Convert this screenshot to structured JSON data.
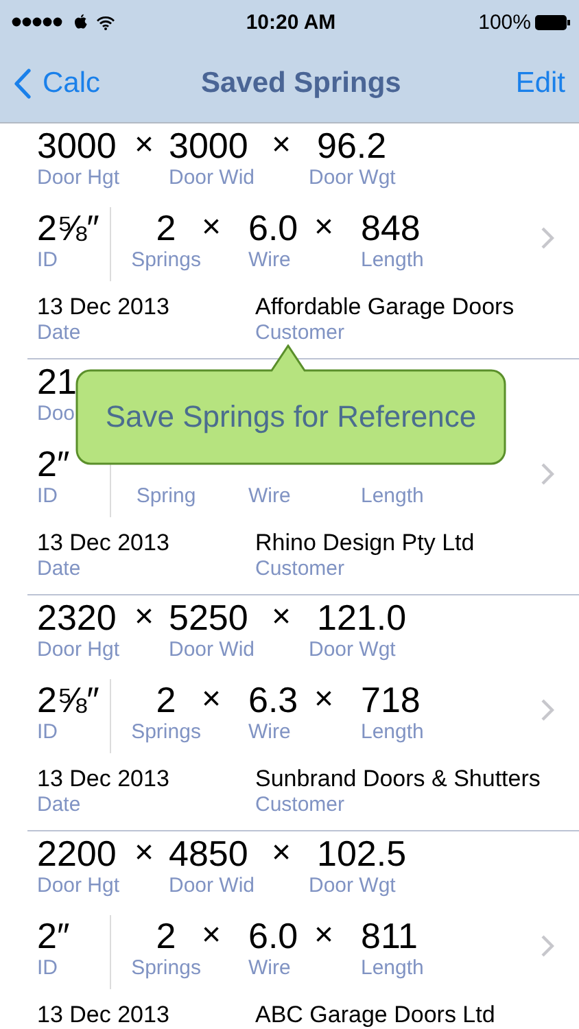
{
  "status_bar": {
    "time": "10:20 AM",
    "battery": "100%"
  },
  "nav": {
    "back": "Calc",
    "title": "Saved Springs",
    "action": "Edit"
  },
  "records": [
    {
      "dims": [
        {
          "value": "3000",
          "label": "Door Hgt"
        },
        {
          "op": "×",
          "value": "3000",
          "label": "Door Wid"
        },
        {
          "op": "×",
          "value": "96.2",
          "label": "Door Wgt"
        }
      ],
      "id": {
        "value": "2⅝″",
        "label": "ID"
      },
      "springs": [
        {
          "value": "2",
          "label": "Springs"
        },
        {
          "op": "×",
          "value": "6.0",
          "label": "Wire"
        },
        {
          "op": "×",
          "value": "848",
          "label": "Length"
        }
      ],
      "date": {
        "value": "13 Dec 2013",
        "label": "Date"
      },
      "customer": {
        "value": "Affordable Garage Doors",
        "label": "Customer"
      }
    },
    {
      "dims": [
        {
          "value": "21",
          "label": "Doo"
        }
      ],
      "id": {
        "value": "2″",
        "label": "ID"
      },
      "springs": [
        {
          "label": "Spring"
        },
        {
          "label": "Wire"
        },
        {
          "label": "Length"
        }
      ],
      "date": {
        "value": "13 Dec 2013",
        "label": "Date"
      },
      "customer": {
        "value": "Rhino Design Pty Ltd",
        "label": "Customer"
      }
    },
    {
      "dims": [
        {
          "value": "2320",
          "label": "Door Hgt"
        },
        {
          "op": "×",
          "value": "5250",
          "label": "Door Wid"
        },
        {
          "op": "×",
          "value": "121.0",
          "label": "Door Wgt"
        }
      ],
      "id": {
        "value": "2⅝″",
        "label": "ID"
      },
      "springs": [
        {
          "value": "2",
          "label": "Springs"
        },
        {
          "op": "×",
          "value": "6.3",
          "label": "Wire"
        },
        {
          "op": "×",
          "value": "718",
          "label": "Length"
        }
      ],
      "date": {
        "value": "13 Dec 2013",
        "label": "Date"
      },
      "customer": {
        "value": "Sunbrand Doors & Shutters",
        "label": "Customer"
      }
    },
    {
      "dims": [
        {
          "value": "2200",
          "label": "Door Hgt"
        },
        {
          "op": "×",
          "value": "4850",
          "label": "Door Wid"
        },
        {
          "op": "×",
          "value": "102.5",
          "label": "Door Wgt"
        }
      ],
      "id": {
        "value": "2″",
        "label": "ID"
      },
      "springs": [
        {
          "value": "2",
          "label": "Springs"
        },
        {
          "op": "×",
          "value": "6.0",
          "label": "Wire"
        },
        {
          "op": "×",
          "value": "811",
          "label": "Length"
        }
      ],
      "date": {
        "value": "13 Dec 2013"
      },
      "customer": {
        "value": "ABC Garage Doors Ltd"
      }
    }
  ],
  "tooltip": {
    "text": "Save Springs for Reference"
  }
}
